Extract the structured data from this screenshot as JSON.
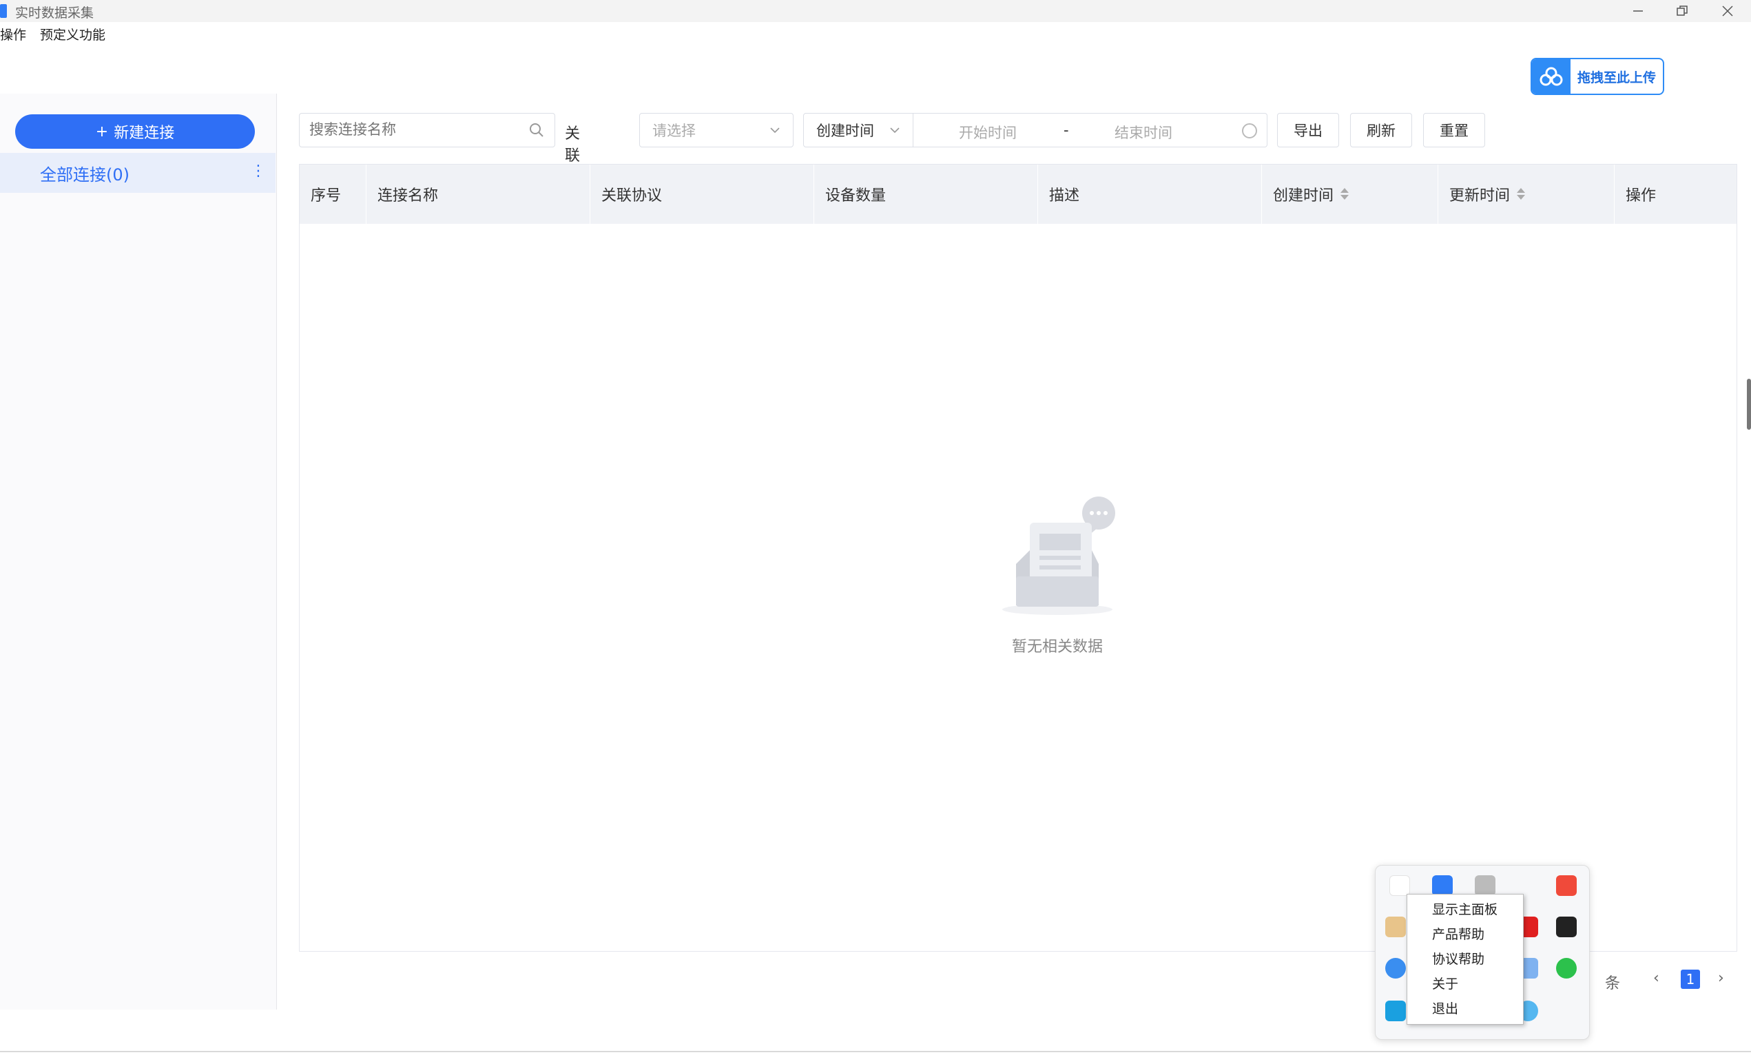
{
  "window": {
    "title": "实时数据采集"
  },
  "menu": {
    "items": [
      "操作",
      "预定义功能"
    ]
  },
  "upload": {
    "label": "拖拽至此上传"
  },
  "sidebar": {
    "new_button": "新建连接",
    "plus": "+",
    "all_connections": "全部连接(0)"
  },
  "filters": {
    "search_placeholder": "搜索连接名称",
    "protocol_label": "关联协议:",
    "protocol_placeholder": "请选择",
    "time_type": "创建时间",
    "start_placeholder": "开始时间",
    "range_separator": "-",
    "end_placeholder": "结束时间",
    "export": "导出",
    "refresh": "刷新",
    "reset": "重置"
  },
  "table": {
    "columns": [
      "序号",
      "连接名称",
      "关联协议",
      "设备数量",
      "描述",
      "创建时间",
      "更新时间",
      "操作"
    ],
    "empty_text": "暂无相关数据"
  },
  "pagination": {
    "unit": "条",
    "current_page": "1",
    "prev": "‹",
    "next": "›"
  },
  "context_menu": {
    "items": [
      "显示主面板",
      "产品帮助",
      "协议帮助",
      "关于",
      "退出"
    ]
  },
  "colors": {
    "accent": "#2f6ff5",
    "upload_accent": "#2e8cf6",
    "header_bg": "#f0f2f6"
  }
}
